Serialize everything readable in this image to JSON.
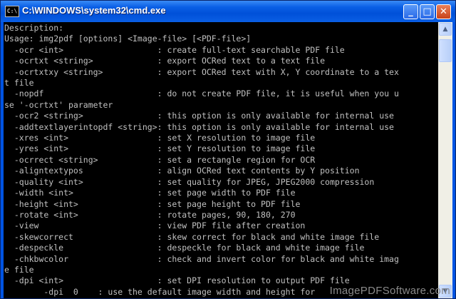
{
  "window": {
    "title": "C:\\WINDOWS\\system32\\cmd.exe",
    "icon": "cmd-icon",
    "icon_label": "C:\\",
    "minimize_glyph": "_",
    "maximize_glyph": "□",
    "close_glyph": "✕"
  },
  "console": {
    "lines": [
      "Description:",
      "Usage: img2pdf [options] <Image-file> [<PDF-file>]",
      "  -ocr <int>                   : create full-text searchable PDF file",
      "  -ocrtxt <string>             : export OCRed text to a text file",
      "  -ocrtxtxy <string>           : export OCRed text with X, Y coordinate to a tex",
      "t file",
      "  -nopdf                       : do not create PDF file, it is useful when you u",
      "se '-ocrtxt' parameter",
      "  -ocr2 <string>               : this option is only available for internal use",
      "  -addtextlayerintopdf <string>: this option is only available for internal use",
      "  -xres <int>                  : set X resolution to image file",
      "  -yres <int>                  : set Y resolution to image file",
      "  -ocrrect <string>            : set a rectangle region for OCR",
      "  -aligntextypos               : align OCRed text contents by Y position",
      "  -quality <int>               : set quality for JPEG, JPEG2000 compression",
      "  -width <int>                 : set page width to PDF file",
      "  -height <int>                : set page height to PDF file",
      "  -rotate <int>                : rotate pages, 90, 180, 270",
      "  -view                        : view PDF file after creation",
      "  -skewcorrect                 : skew correct for black and white image file",
      "  -despeckle                   : despeckle for black and white image file",
      "  -chkbwcolor                  : check and invert color for black and white imag",
      "e file",
      "  -dpi <int>                   : set DPI resolution to output PDF file",
      "        -dpi  0    : use the default image width and height for"
    ]
  },
  "scrollbar": {
    "up_glyph": "▲",
    "down_glyph": "▼"
  },
  "watermark": {
    "text": "ImagePDFSoftware.com"
  }
}
